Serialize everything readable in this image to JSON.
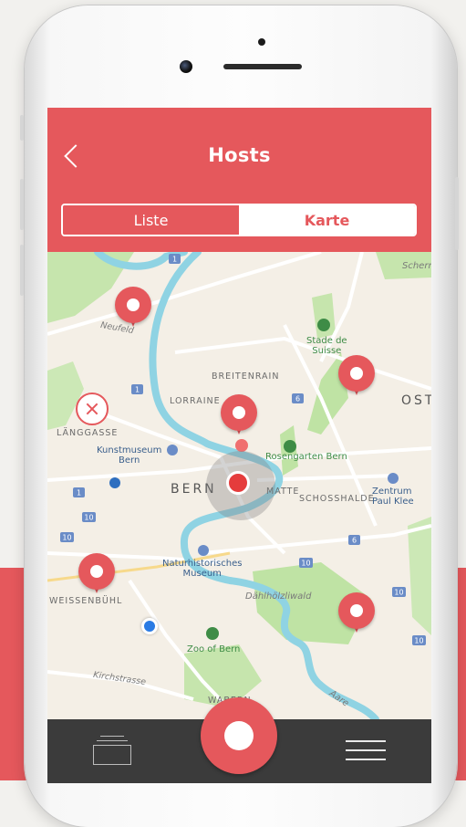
{
  "header": {
    "title": "Hosts",
    "back_icon": "chevron-left-icon"
  },
  "tabs": [
    {
      "label": "Liste",
      "selected": false
    },
    {
      "label": "Karte",
      "selected": true
    }
  ],
  "map": {
    "labels": {
      "neufeld": "Neufeld",
      "stade": "Stade de\nSuisse",
      "breitenrain": "BREITENRAIN",
      "lorraine": "LORRAINE",
      "ost": "OST",
      "langgasse": "LÄNGGASSE",
      "kunstmuseum": "Kunstmuseum\nBern",
      "rosengarten": "Rosengarten Bern",
      "bern": "BERN",
      "matte": "MATTE",
      "schosshalde": "SCHOSSHALDE",
      "zentrum": "Zentrum\nPaul Klee",
      "naturhistorisches": "Naturhistorisches\nMuseum",
      "weissenbuhl": "WEISSENBÜHL",
      "dahlholzliwald": "Dählhölzliwald",
      "zoo": "Zoo of Bern",
      "kirchstrasse": "Kirchstrasse",
      "wabern": "WABERN",
      "aare": "Aare",
      "scherr": "Scherr"
    },
    "road_badges": [
      "1",
      "1",
      "6",
      "1",
      "10",
      "10",
      "6",
      "10",
      "10",
      "10"
    ]
  },
  "colors": {
    "accent": "#e5585c",
    "bottom_bar": "#3b3b3b",
    "water": "#8fd3e3",
    "park": "#bfe3a4"
  }
}
